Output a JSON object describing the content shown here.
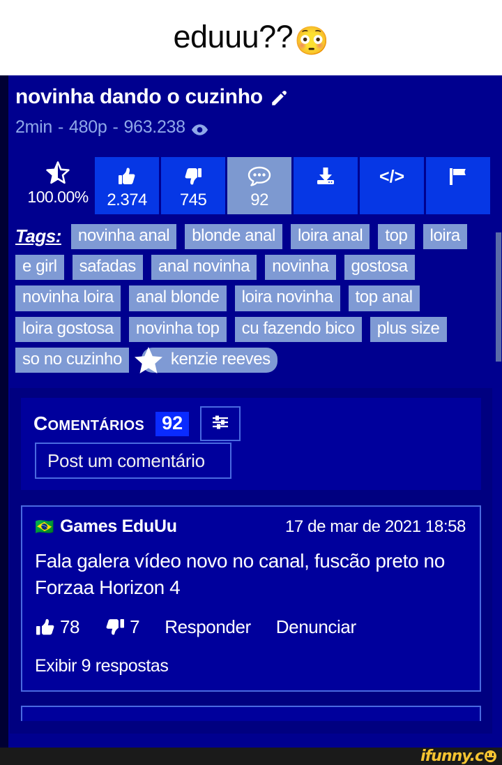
{
  "caption": {
    "text": "eduuu??",
    "emoji": "😳",
    "emoji_name": "flushed-face-emoji"
  },
  "video": {
    "title": "novinha dando o cuzinho",
    "edit_icon": "pencil-icon",
    "duration": "2min",
    "quality": "480p",
    "views": "963.238",
    "views_icon": "eye-icon",
    "meta_separator": "-"
  },
  "actions": {
    "rating": {
      "icon": "half-star-icon",
      "percent": "100.00%"
    },
    "buttons": [
      {
        "name": "like-button",
        "icon": "thumbs-up-icon",
        "count": "2.374",
        "active": false
      },
      {
        "name": "dislike-button",
        "icon": "thumbs-down-icon",
        "count": "745",
        "active": false
      },
      {
        "name": "comments-button",
        "icon": "comment-bubble-icon",
        "count": "92",
        "active": true
      },
      {
        "name": "download-button",
        "icon": "download-icon",
        "count": "",
        "active": false
      },
      {
        "name": "embed-button",
        "icon": "code-icon",
        "count": "</>",
        "active": false
      },
      {
        "name": "report-button",
        "icon": "flag-icon",
        "count": "",
        "active": false
      }
    ]
  },
  "tags": {
    "label": "Tags:",
    "items": [
      "novinha anal",
      "blonde anal",
      "loira anal",
      "top",
      "loira",
      "e girl",
      "safadas",
      "anal novinha",
      "novinha",
      "gostosa",
      "novinha loira",
      "anal blonde",
      "loira novinha",
      "top anal",
      "loira gostosa",
      "novinha top",
      "cu fazendo bico",
      "plus size",
      "so no cuzinho"
    ],
    "pornstar": {
      "name": "kenzie reeves",
      "icon": "star-badge-icon"
    }
  },
  "comments": {
    "heading": "Comentários",
    "count": "92",
    "filter_icon": "sliders-filter-icon",
    "post_placeholder": "Post um comentário",
    "list": [
      {
        "avatar_flag": "🇧🇷",
        "author": "Games EduUu",
        "date": "17 de mar de 2021 18:58",
        "text": "Fala galera vídeo novo no canal, fuscão preto no Forzaa Horizon 4",
        "likes": "78",
        "dislikes": "7",
        "reply_label": "Responder",
        "report_label": "Denunciar",
        "show_replies_label": "Exibir 9 respostas"
      }
    ]
  },
  "footer": {
    "watermark": "ifunny.c",
    "watermark_icon": "ifunny-smiley-icon"
  },
  "colors": {
    "page_bg": "#00008f",
    "panel_bg": "#000080",
    "card_bg": "#00009c",
    "accent_blue": "#0637e5",
    "tag_bg": "#7f9ad4",
    "meta_text": "#8fa8e8",
    "border": "#4a6ae0",
    "count_badge": "#0a2bff",
    "watermark": "#f5c431"
  }
}
